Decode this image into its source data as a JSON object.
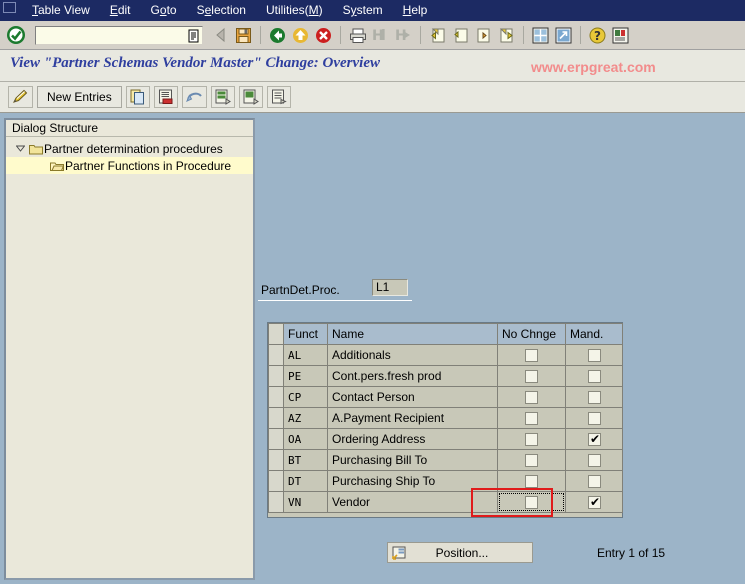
{
  "menu": {
    "items": [
      {
        "label": "Table View",
        "accel_index": 0
      },
      {
        "label": "Edit",
        "accel_index": 0
      },
      {
        "label": "Goto",
        "accel_index": 1
      },
      {
        "label": "Selection",
        "accel_index": 1
      },
      {
        "label": "Utilities(M)",
        "accel_index": 9
      },
      {
        "label": "System",
        "accel_index": 1
      },
      {
        "label": "Help",
        "accel_index": 0
      }
    ]
  },
  "toolbar": {
    "ok_icon": "green-check-icon",
    "command_field_value": "",
    "command_field_placeholder": "",
    "command_dropdown_icon": "dropdown-list-icon",
    "buttons": [
      {
        "name": "back-arrow-icon",
        "label": ""
      },
      {
        "name": "save-icon",
        "label": ""
      },
      {
        "name": "back-green-icon",
        "label": ""
      },
      {
        "name": "exit-yellow-icon",
        "label": ""
      },
      {
        "name": "cancel-red-icon",
        "label": ""
      },
      {
        "name": "print-icon",
        "label": ""
      },
      {
        "name": "find-icon",
        "label": ""
      },
      {
        "name": "find-next-icon",
        "label": ""
      },
      {
        "name": "first-page-icon",
        "label": ""
      },
      {
        "name": "previous-page-icon",
        "label": ""
      },
      {
        "name": "next-page-icon",
        "label": ""
      },
      {
        "name": "last-page-icon",
        "label": ""
      },
      {
        "name": "new-session-icon",
        "label": ""
      },
      {
        "name": "create-shortcut-icon",
        "label": ""
      },
      {
        "name": "help-icon",
        "label": ""
      },
      {
        "name": "customize-local-layout-icon",
        "label": ""
      }
    ]
  },
  "title": {
    "text": "View \"Partner Schemas Vendor Master\" Change: Overview",
    "watermark": "www.erpgreat.com",
    "watermark_color": "#f28c8c",
    "title_color": "#2f3f9f"
  },
  "apptoolbar": {
    "buttons": [
      {
        "name": "display-change-pencil-icon",
        "label": ""
      },
      {
        "name": "new-entries-button",
        "label": "New Entries"
      },
      {
        "name": "copy-as-icon",
        "label": ""
      },
      {
        "name": "delete-icon",
        "label": ""
      },
      {
        "name": "undo-icon",
        "label": ""
      },
      {
        "name": "select-all-icon",
        "label": ""
      },
      {
        "name": "deselect-all-icon",
        "label": ""
      },
      {
        "name": "details-icon",
        "label": ""
      }
    ]
  },
  "sidebar": {
    "header": "Dialog Structure",
    "tree": [
      {
        "label": "Partner determination procedures",
        "level": 1,
        "expanded": true,
        "selected": false,
        "icon": "folder-icon"
      },
      {
        "label": "Partner Functions in Procedure",
        "level": 2,
        "expanded": false,
        "selected": true,
        "icon": "folder-open-icon"
      }
    ]
  },
  "form": {
    "partndet_proc_label": "PartnDet.Proc.",
    "partndet_proc_value": "L1"
  },
  "table": {
    "columns": [
      "Funct",
      "Name",
      "No Chnge",
      "Mand."
    ],
    "rows": [
      {
        "funct": "AL",
        "name": "Additionals",
        "no_chnge": false,
        "mand": false,
        "focused": false
      },
      {
        "funct": "PE",
        "name": "Cont.pers.fresh prod",
        "no_chnge": false,
        "mand": false,
        "focused": false
      },
      {
        "funct": "CP",
        "name": "Contact Person",
        "no_chnge": false,
        "mand": false,
        "focused": false
      },
      {
        "funct": "AZ",
        "name": "A.Payment Recipient",
        "no_chnge": false,
        "mand": false,
        "focused": false
      },
      {
        "funct": "OA",
        "name": "Ordering Address",
        "no_chnge": false,
        "mand": true,
        "focused": false
      },
      {
        "funct": "BT",
        "name": "Purchasing Bill To",
        "no_chnge": false,
        "mand": false,
        "focused": false
      },
      {
        "funct": "DT",
        "name": "Purchasing Ship To",
        "no_chnge": false,
        "mand": false,
        "focused": false
      },
      {
        "funct": "VN",
        "name": "Vendor",
        "no_chnge": false,
        "mand": true,
        "focused": true
      }
    ],
    "highlight_color": "#e01b1b"
  },
  "footer": {
    "position_button": "Position...",
    "position_icon": "position-icon",
    "entry_status": "Entry 1 of 15"
  }
}
